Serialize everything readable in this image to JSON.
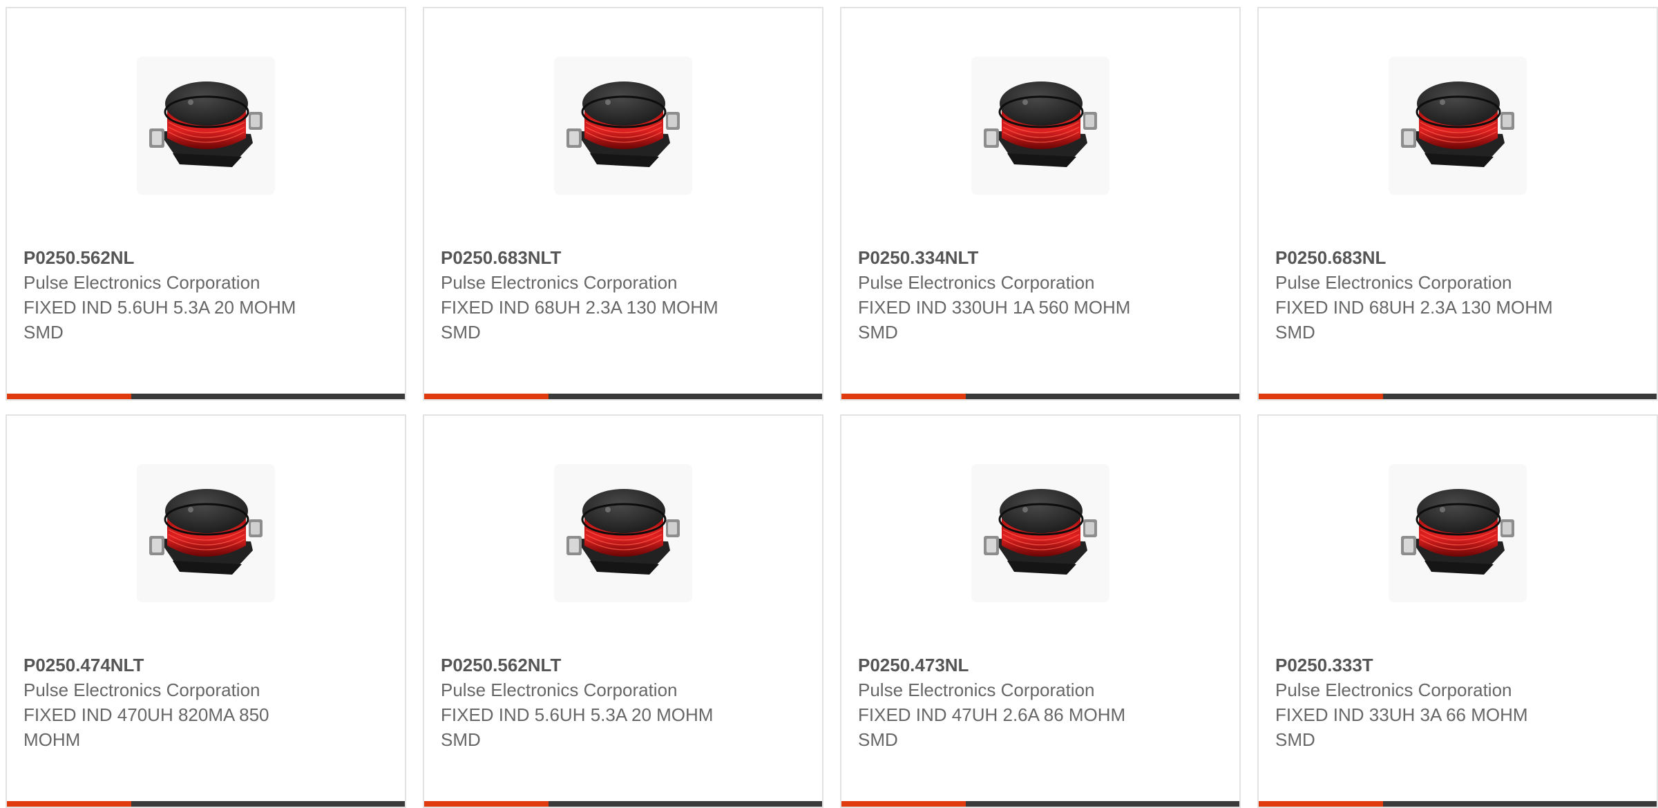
{
  "colors": {
    "accent": "#e03a0f",
    "bar": "#3a3a3a",
    "card_border": "#e2e2e2",
    "text": "#666666"
  },
  "products": [
    {
      "part_number": "P0250.562NL",
      "manufacturer": "Pulse Electronics Corporation",
      "description": "FIXED IND 5.6UH 5.3A 20 MOHM SMD",
      "image": "inductor-image"
    },
    {
      "part_number": "P0250.683NLT",
      "manufacturer": "Pulse Electronics Corporation",
      "description": "FIXED IND 68UH 2.3A 130 MOHM SMD",
      "image": "inductor-image"
    },
    {
      "part_number": "P0250.334NLT",
      "manufacturer": "Pulse Electronics Corporation",
      "description": "FIXED IND 330UH 1A 560 MOHM SMD",
      "image": "inductor-image"
    },
    {
      "part_number": "P0250.683NL",
      "manufacturer": "Pulse Electronics Corporation",
      "description": "FIXED IND 68UH 2.3A 130 MOHM SMD",
      "image": "inductor-image"
    },
    {
      "part_number": "P0250.474NLT",
      "manufacturer": "Pulse Electronics Corporation",
      "description": "FIXED IND 470UH 820MA 850 MOHM",
      "image": "inductor-image"
    },
    {
      "part_number": "P0250.562NLT",
      "manufacturer": "Pulse Electronics Corporation",
      "description": "FIXED IND 5.6UH 5.3A 20 MOHM SMD",
      "image": "inductor-image"
    },
    {
      "part_number": "P0250.473NL",
      "manufacturer": "Pulse Electronics Corporation",
      "description": "FIXED IND 47UH 2.6A 86 MOHM SMD",
      "image": "inductor-image"
    },
    {
      "part_number": "P0250.333T",
      "manufacturer": "Pulse Electronics Corporation",
      "description": "FIXED IND 33UH 3A 66 MOHM SMD",
      "image": "inductor-image"
    }
  ]
}
